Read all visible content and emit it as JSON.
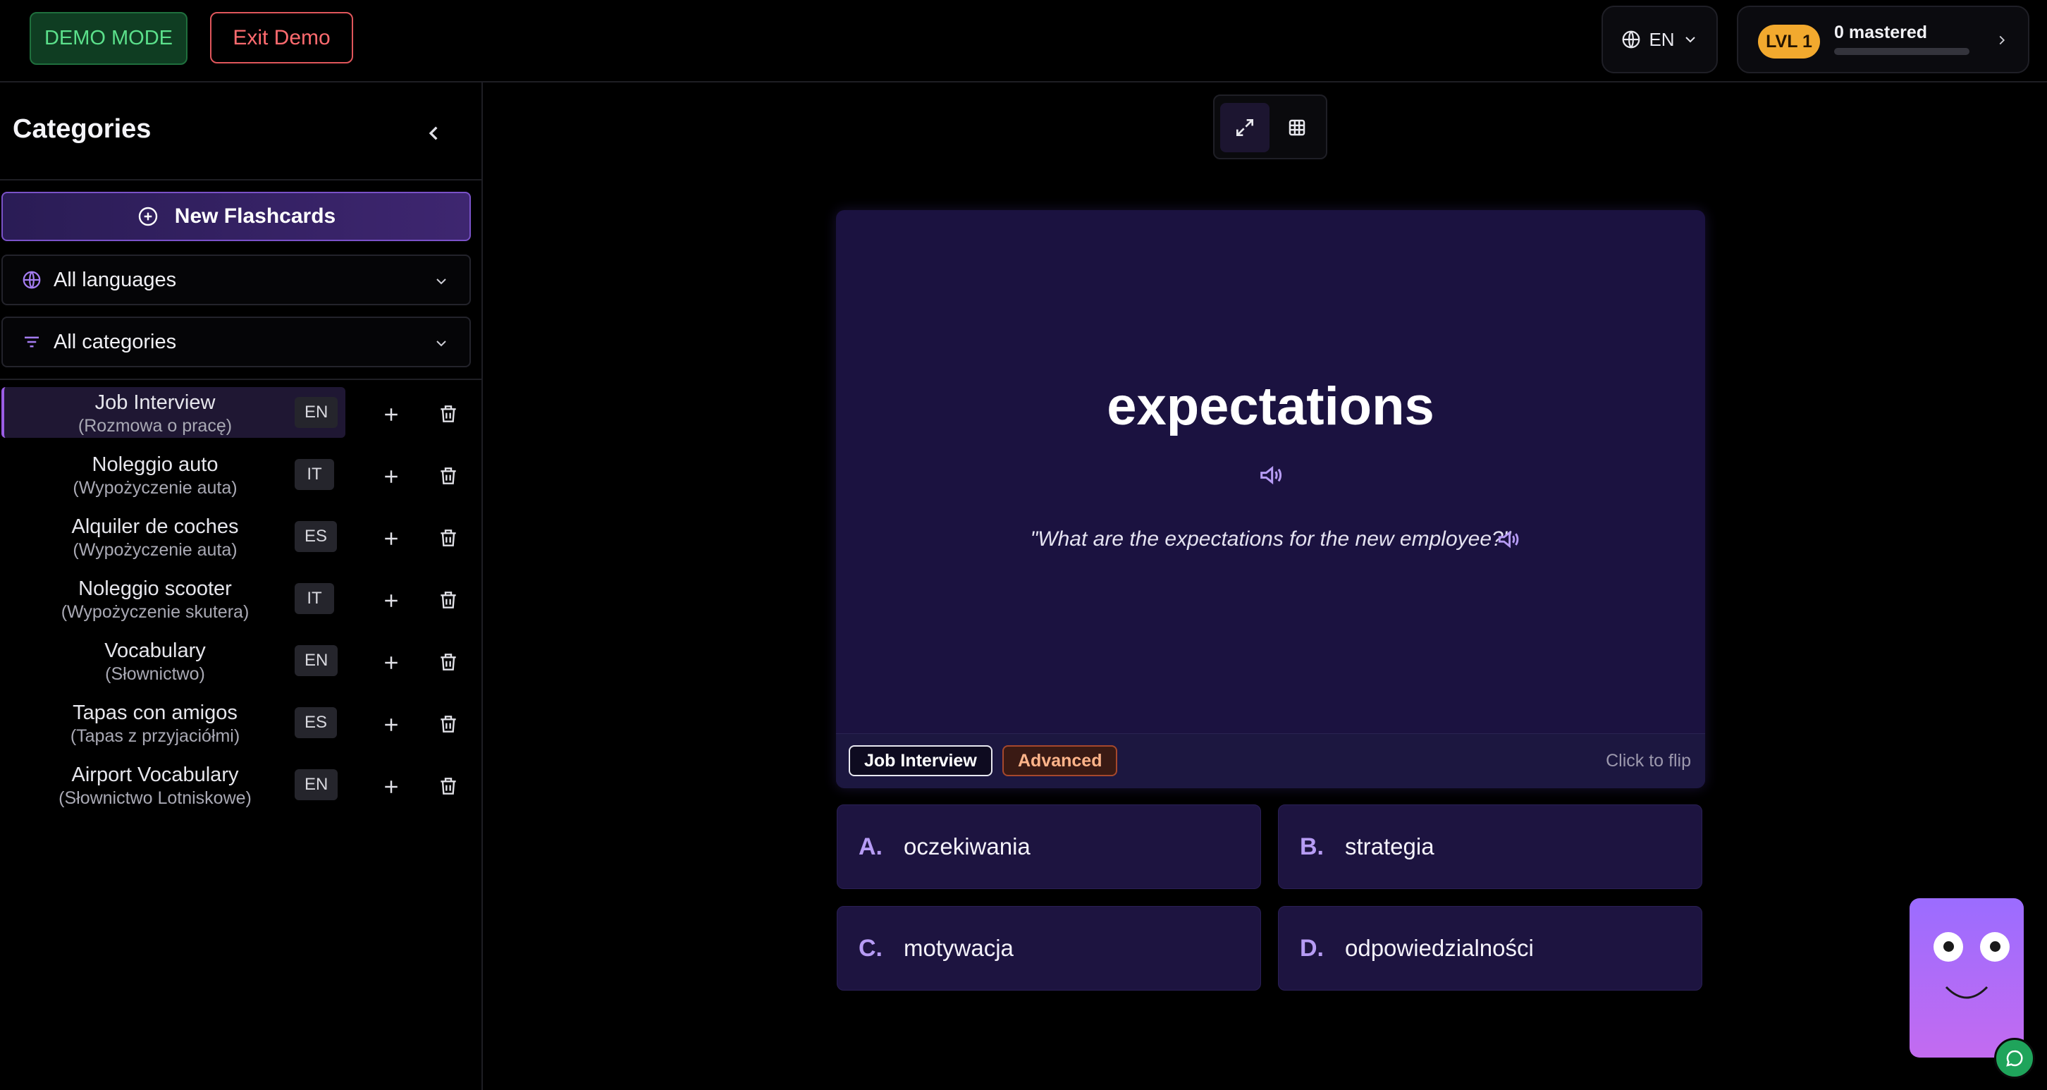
{
  "topbar": {
    "demo_badge": "DEMO MODE",
    "exit_demo": "Exit Demo",
    "language": "EN",
    "level": "LVL 1",
    "mastered": "0 mastered",
    "mastery_progress": 0.0,
    "colors": {
      "demo": "#5be08b",
      "exit": "#ff6b6f",
      "level": "#f2a92e"
    }
  },
  "sidebar": {
    "title": "Categories",
    "new_flashcards": "New Flashcards",
    "language_filter": "All languages",
    "category_filter": "All categories",
    "categories": [
      {
        "name": "Job Interview",
        "translation": "(Rozmowa o pracę)",
        "lang": "EN",
        "active": true
      },
      {
        "name": "Noleggio auto",
        "translation": "(Wypożyczenie auta)",
        "lang": "IT"
      },
      {
        "name": "Alquiler de coches",
        "translation": "(Wypożyczenie auta)",
        "lang": "ES"
      },
      {
        "name": "Noleggio scooter",
        "translation": "(Wypożyczenie skutera)",
        "lang": "IT"
      },
      {
        "name": "Vocabulary",
        "translation": "(Słownictwo)",
        "lang": "EN"
      },
      {
        "name": "Tapas con amigos",
        "translation": "(Tapas z przyjaciółmi)",
        "lang": "ES"
      },
      {
        "name": "Airport Vocabulary",
        "translation": "(Słownictwo Lotniskowe)",
        "lang": "EN"
      }
    ]
  },
  "card": {
    "word": "expectations",
    "example": "\"What are the expectations for the new employee?\"",
    "category_tag": "Job Interview",
    "level_tag": "Advanced",
    "flip_hint": "Click to flip",
    "accent": "#b79cf5"
  },
  "answers": [
    {
      "letter": "A.",
      "text": "oczekiwania"
    },
    {
      "letter": "B.",
      "text": "strategia"
    },
    {
      "letter": "C.",
      "text": "motywacja"
    },
    {
      "letter": "D.",
      "text": "odpowiedzialności"
    }
  ]
}
